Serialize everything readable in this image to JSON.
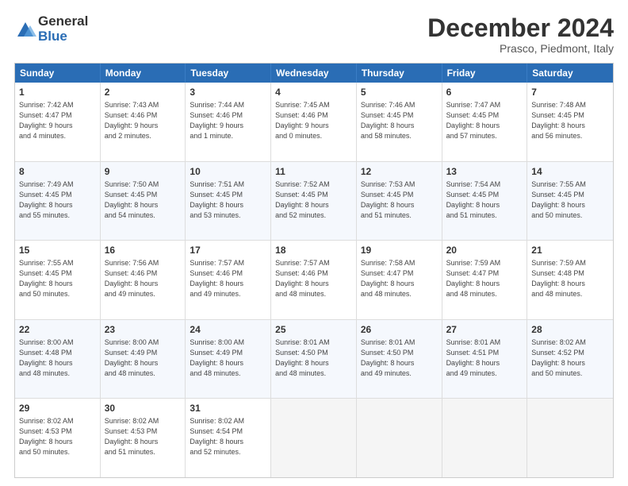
{
  "logo": {
    "general": "General",
    "blue": "Blue"
  },
  "header": {
    "month": "December 2024",
    "location": "Prasco, Piedmont, Italy"
  },
  "weekdays": [
    "Sunday",
    "Monday",
    "Tuesday",
    "Wednesday",
    "Thursday",
    "Friday",
    "Saturday"
  ],
  "rows": [
    [
      {
        "day": "1",
        "lines": [
          "Sunrise: 7:42 AM",
          "Sunset: 4:47 PM",
          "Daylight: 9 hours",
          "and 4 minutes."
        ]
      },
      {
        "day": "2",
        "lines": [
          "Sunrise: 7:43 AM",
          "Sunset: 4:46 PM",
          "Daylight: 9 hours",
          "and 2 minutes."
        ]
      },
      {
        "day": "3",
        "lines": [
          "Sunrise: 7:44 AM",
          "Sunset: 4:46 PM",
          "Daylight: 9 hours",
          "and 1 minute."
        ]
      },
      {
        "day": "4",
        "lines": [
          "Sunrise: 7:45 AM",
          "Sunset: 4:46 PM",
          "Daylight: 9 hours",
          "and 0 minutes."
        ]
      },
      {
        "day": "5",
        "lines": [
          "Sunrise: 7:46 AM",
          "Sunset: 4:45 PM",
          "Daylight: 8 hours",
          "and 58 minutes."
        ]
      },
      {
        "day": "6",
        "lines": [
          "Sunrise: 7:47 AM",
          "Sunset: 4:45 PM",
          "Daylight: 8 hours",
          "and 57 minutes."
        ]
      },
      {
        "day": "7",
        "lines": [
          "Sunrise: 7:48 AM",
          "Sunset: 4:45 PM",
          "Daylight: 8 hours",
          "and 56 minutes."
        ]
      }
    ],
    [
      {
        "day": "8",
        "lines": [
          "Sunrise: 7:49 AM",
          "Sunset: 4:45 PM",
          "Daylight: 8 hours",
          "and 55 minutes."
        ]
      },
      {
        "day": "9",
        "lines": [
          "Sunrise: 7:50 AM",
          "Sunset: 4:45 PM",
          "Daylight: 8 hours",
          "and 54 minutes."
        ]
      },
      {
        "day": "10",
        "lines": [
          "Sunrise: 7:51 AM",
          "Sunset: 4:45 PM",
          "Daylight: 8 hours",
          "and 53 minutes."
        ]
      },
      {
        "day": "11",
        "lines": [
          "Sunrise: 7:52 AM",
          "Sunset: 4:45 PM",
          "Daylight: 8 hours",
          "and 52 minutes."
        ]
      },
      {
        "day": "12",
        "lines": [
          "Sunrise: 7:53 AM",
          "Sunset: 4:45 PM",
          "Daylight: 8 hours",
          "and 51 minutes."
        ]
      },
      {
        "day": "13",
        "lines": [
          "Sunrise: 7:54 AM",
          "Sunset: 4:45 PM",
          "Daylight: 8 hours",
          "and 51 minutes."
        ]
      },
      {
        "day": "14",
        "lines": [
          "Sunrise: 7:55 AM",
          "Sunset: 4:45 PM",
          "Daylight: 8 hours",
          "and 50 minutes."
        ]
      }
    ],
    [
      {
        "day": "15",
        "lines": [
          "Sunrise: 7:55 AM",
          "Sunset: 4:45 PM",
          "Daylight: 8 hours",
          "and 50 minutes."
        ]
      },
      {
        "day": "16",
        "lines": [
          "Sunrise: 7:56 AM",
          "Sunset: 4:46 PM",
          "Daylight: 8 hours",
          "and 49 minutes."
        ]
      },
      {
        "day": "17",
        "lines": [
          "Sunrise: 7:57 AM",
          "Sunset: 4:46 PM",
          "Daylight: 8 hours",
          "and 49 minutes."
        ]
      },
      {
        "day": "18",
        "lines": [
          "Sunrise: 7:57 AM",
          "Sunset: 4:46 PM",
          "Daylight: 8 hours",
          "and 48 minutes."
        ]
      },
      {
        "day": "19",
        "lines": [
          "Sunrise: 7:58 AM",
          "Sunset: 4:47 PM",
          "Daylight: 8 hours",
          "and 48 minutes."
        ]
      },
      {
        "day": "20",
        "lines": [
          "Sunrise: 7:59 AM",
          "Sunset: 4:47 PM",
          "Daylight: 8 hours",
          "and 48 minutes."
        ]
      },
      {
        "day": "21",
        "lines": [
          "Sunrise: 7:59 AM",
          "Sunset: 4:48 PM",
          "Daylight: 8 hours",
          "and 48 minutes."
        ]
      }
    ],
    [
      {
        "day": "22",
        "lines": [
          "Sunrise: 8:00 AM",
          "Sunset: 4:48 PM",
          "Daylight: 8 hours",
          "and 48 minutes."
        ]
      },
      {
        "day": "23",
        "lines": [
          "Sunrise: 8:00 AM",
          "Sunset: 4:49 PM",
          "Daylight: 8 hours",
          "and 48 minutes."
        ]
      },
      {
        "day": "24",
        "lines": [
          "Sunrise: 8:00 AM",
          "Sunset: 4:49 PM",
          "Daylight: 8 hours",
          "and 48 minutes."
        ]
      },
      {
        "day": "25",
        "lines": [
          "Sunrise: 8:01 AM",
          "Sunset: 4:50 PM",
          "Daylight: 8 hours",
          "and 48 minutes."
        ]
      },
      {
        "day": "26",
        "lines": [
          "Sunrise: 8:01 AM",
          "Sunset: 4:50 PM",
          "Daylight: 8 hours",
          "and 49 minutes."
        ]
      },
      {
        "day": "27",
        "lines": [
          "Sunrise: 8:01 AM",
          "Sunset: 4:51 PM",
          "Daylight: 8 hours",
          "and 49 minutes."
        ]
      },
      {
        "day": "28",
        "lines": [
          "Sunrise: 8:02 AM",
          "Sunset: 4:52 PM",
          "Daylight: 8 hours",
          "and 50 minutes."
        ]
      }
    ],
    [
      {
        "day": "29",
        "lines": [
          "Sunrise: 8:02 AM",
          "Sunset: 4:53 PM",
          "Daylight: 8 hours",
          "and 50 minutes."
        ]
      },
      {
        "day": "30",
        "lines": [
          "Sunrise: 8:02 AM",
          "Sunset: 4:53 PM",
          "Daylight: 8 hours",
          "and 51 minutes."
        ]
      },
      {
        "day": "31",
        "lines": [
          "Sunrise: 8:02 AM",
          "Sunset: 4:54 PM",
          "Daylight: 8 hours",
          "and 52 minutes."
        ]
      },
      {
        "day": "",
        "lines": []
      },
      {
        "day": "",
        "lines": []
      },
      {
        "day": "",
        "lines": []
      },
      {
        "day": "",
        "lines": []
      }
    ]
  ]
}
